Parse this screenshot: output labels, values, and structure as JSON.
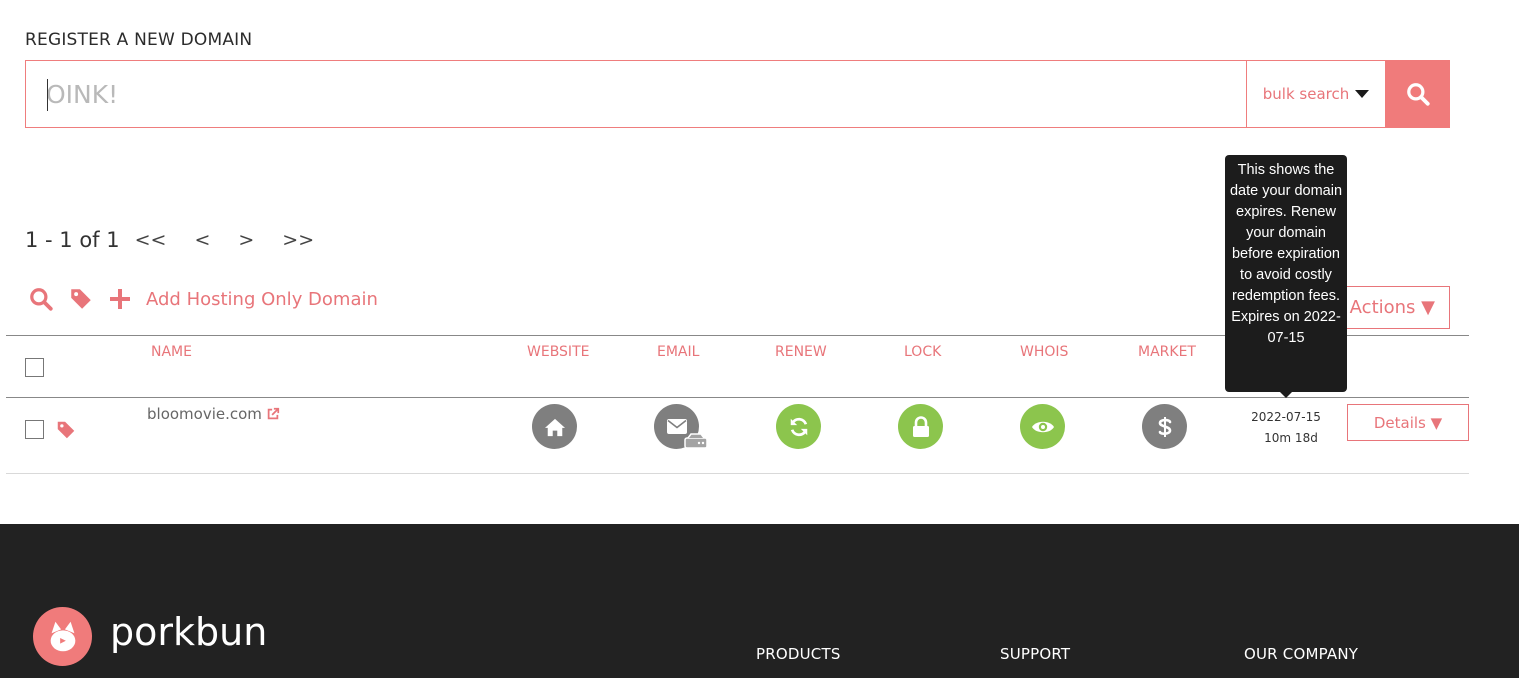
{
  "register": {
    "title": "REGISTER A NEW DOMAIN",
    "placeholder": "OINK!",
    "bulk_label": "bulk search"
  },
  "pager": {
    "range": "1 - 1 of 1",
    "first": "<<",
    "prev": "<",
    "next": ">",
    "last": ">>"
  },
  "tools": {
    "add_hosting": "Add Hosting Only Domain",
    "bulk_actions": "Actions ▼"
  },
  "table": {
    "columns": {
      "name": "NAME",
      "website": "WEBSITE",
      "email": "EMAIL",
      "renew": "RENEW",
      "lock": "LOCK",
      "whois": "WHOIS",
      "market": "MARKET"
    },
    "rows": [
      {
        "domain": "bloomovie.com",
        "expiry_date": "2022-07-15",
        "expiry_remaining": "10m 18d",
        "details_label": "Details ▼"
      }
    ]
  },
  "tooltip": {
    "text": "This shows the date your domain expires. Renew your domain before expiration to avoid costly redemption fees. Expires on 2022-07-15"
  },
  "footer": {
    "brand": "porkbun",
    "columns": [
      "PRODUCTS",
      "SUPPORT",
      "OUR COMPANY"
    ]
  },
  "colors": {
    "accent": "#f07b7b",
    "accent_text": "#e8757a",
    "status_on": "#8cc54d",
    "status_off": "#7f7f7f",
    "footer_bg": "#222222"
  }
}
